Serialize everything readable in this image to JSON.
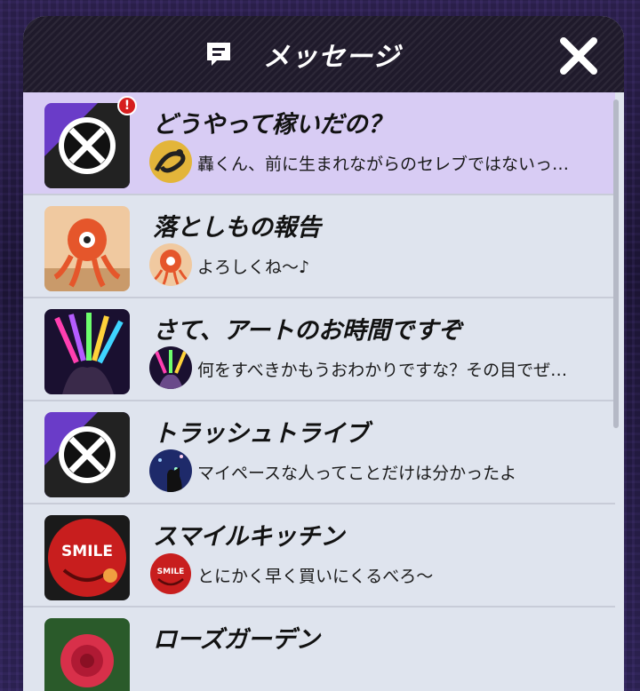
{
  "header": {
    "title": "メッセージ",
    "icon": "message-icon",
    "close_icon": "close-icon"
  },
  "messages": [
    {
      "title": "どうやって稼いだの？",
      "preview": "轟くん、前に生まれながらのセレブではないっ…",
      "unread": true,
      "unread_mark": "!",
      "thumb": "x-logo"
    },
    {
      "title": "落としもの報告",
      "preview": "よろしくね～♪",
      "unread": false,
      "thumb": "octopus"
    },
    {
      "title": "さて、アートのお時間ですぞ",
      "preview": "何をすべきかもうおわかりですな？その目でぜ…",
      "unread": false,
      "thumb": "glowsticks"
    },
    {
      "title": "トラッシュトライブ",
      "preview": "マイペースな人ってことだけは分かったよ",
      "unread": false,
      "thumb": "x-logo"
    },
    {
      "title": "スマイルキッチン",
      "preview": "とにかく早く買いにくるべろ～",
      "unread": false,
      "thumb": "smile-logo",
      "thumb_text": "SMILE"
    },
    {
      "title": "ローズガーデン",
      "preview": "",
      "unread": false,
      "thumb": "rose"
    }
  ],
  "colors": {
    "unread_row": "#d8ccf4",
    "row": "#dfe4ee",
    "header": "#1f1a2b",
    "badge": "#d61e1e"
  }
}
